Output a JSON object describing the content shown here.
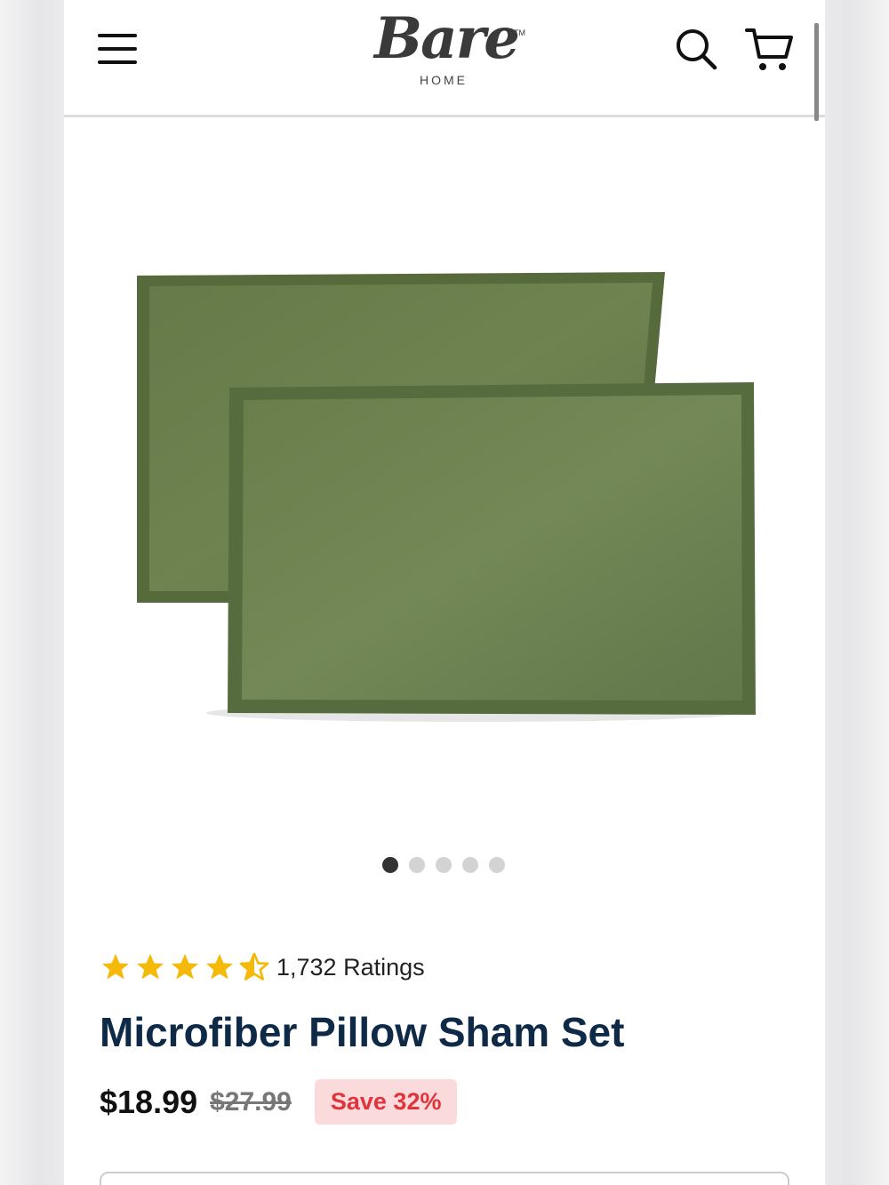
{
  "header": {
    "logo_text": "Bare",
    "logo_tm": "TM",
    "logo_sub": "HOME",
    "menu_icon": "hamburger-menu-icon",
    "search_icon": "search-icon",
    "cart_icon": "cart-icon"
  },
  "gallery": {
    "image_alt": "Green microfiber pillow shams",
    "pillow_color": "#6b7f4c",
    "dots_count": 5,
    "active_dot": 1
  },
  "product": {
    "rating": 4.5,
    "rating_count_label": "1,732 Ratings",
    "title": "Microfiber Pillow Sham Set",
    "price": "$18.99",
    "price_old": "$27.99",
    "save_label": "Save 32%"
  },
  "colors": {
    "title": "#0e2a47",
    "star": "#f5b90a",
    "save_bg": "#fbdadb",
    "save_text": "#e0343c"
  }
}
